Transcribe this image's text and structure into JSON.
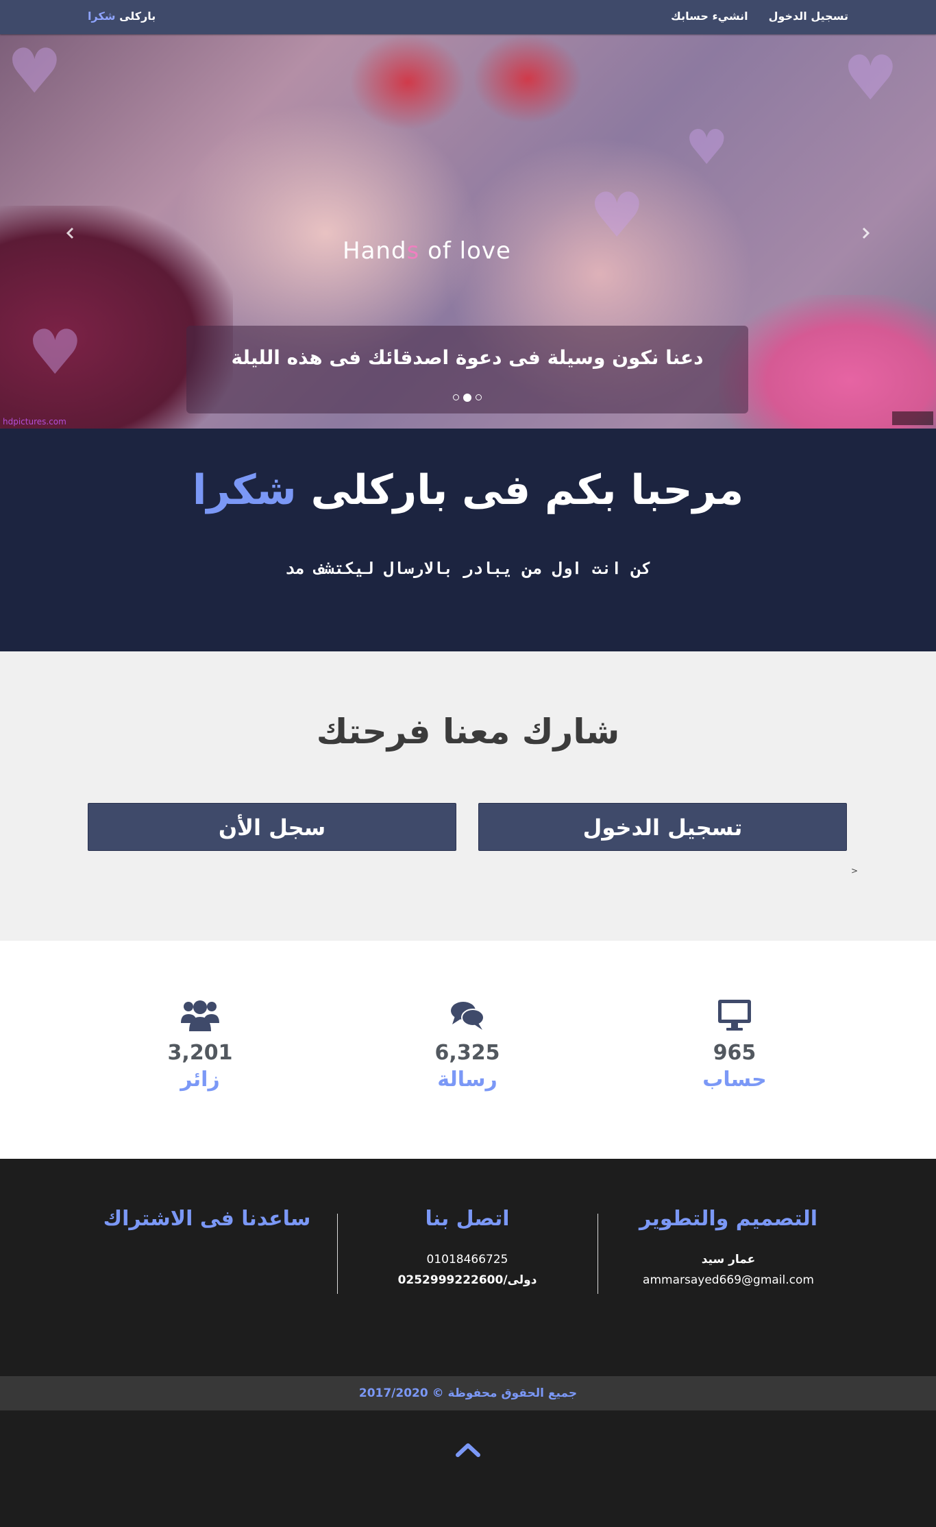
{
  "navbar": {
    "brand_part1": "باركلى",
    "brand_part2": "شكرا",
    "links": [
      {
        "label": "تسجيل الدخول"
      },
      {
        "label": "انشيء حسابك"
      }
    ]
  },
  "hero": {
    "image_text_part1": "Hand",
    "image_text_part2": "s",
    "image_text_part3": " of love",
    "caption": "دعنا نكون وسيلة فى دعوة اصدقائك فى هذه الليلة",
    "credit_left": "hdpictures.com",
    "prev_icon": "chevron-left-icon",
    "next_icon": "chevron-right-icon",
    "slide_count": 3,
    "active_slide": 2
  },
  "welcome": {
    "title_main": "مرحبا بكم فى باركلى",
    "title_accent": "شكرا",
    "subtitle": "كن انت اول من يبادر بالارسال ليكتشف مد"
  },
  "share": {
    "title": "شارك معنا فرحتك",
    "login_button": "تسجيل الدخول",
    "register_button": "سجل الأن",
    "caret": ">"
  },
  "stats": [
    {
      "icon": "monitor-icon",
      "number": "965",
      "label": "حساب"
    },
    {
      "icon": "chat-icon",
      "number": "6,325",
      "label": "رسالة"
    },
    {
      "icon": "users-icon",
      "number": "3,201",
      "label": "زائر"
    }
  ],
  "footer": {
    "design": {
      "heading": "التصميم والتطوير",
      "name": "عمار سيد",
      "email": "ammarsayed669@gmail.com"
    },
    "contact": {
      "heading": "اتصل بنا",
      "phone_local": "01018466725",
      "phone_intl": "دولى/0252999222600"
    },
    "subscribe": {
      "heading": "ساعدنا فى الاشتراك"
    },
    "copyright": "جميع الحقوق محفوظة © 2017/2020",
    "top_icon": "chevron-up-icon"
  },
  "colors": {
    "navbar": "#3f4a6a",
    "accent": "#7b98f6",
    "welcome_bg": "#1c2440",
    "footer_bg": "#1d1d1d"
  }
}
